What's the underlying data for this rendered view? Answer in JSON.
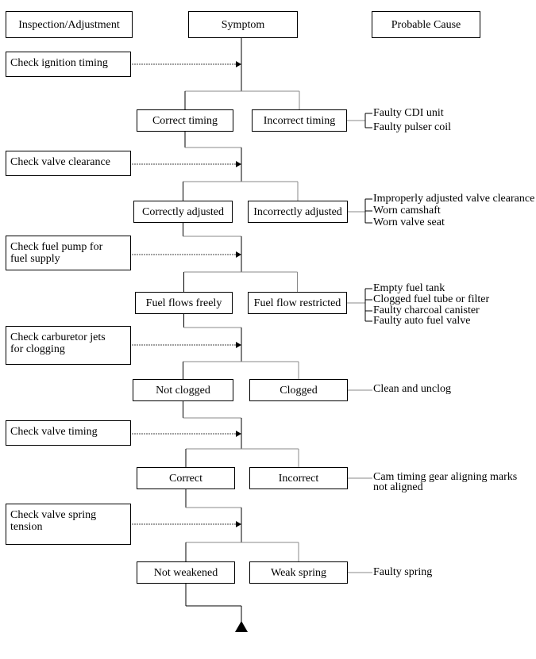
{
  "headers": {
    "inspection": "Inspection/Adjustment",
    "symptom": "Symptom",
    "cause": "Probable Cause"
  },
  "steps": [
    {
      "check": "Check ignition timing",
      "ok": "Correct timing",
      "ng": "Incorrect timing",
      "causes": [
        "Faulty CDI unit",
        "Faulty pulser coil"
      ]
    },
    {
      "check": "Check valve clearance",
      "ok": "Correctly adjusted",
      "ng": "Incorrectly adjusted",
      "causes": [
        "Improperly adjusted valve clearance",
        "Worn camshaft",
        "Worn valve seat"
      ]
    },
    {
      "check": "Check fuel pump for\nfuel supply",
      "ok": "Fuel flows freely",
      "ng": "Fuel flow restricted",
      "causes": [
        "Empty fuel tank",
        "Clogged fuel tube or filter",
        "Faulty charcoal canister",
        "Faulty auto fuel valve"
      ]
    },
    {
      "check": "Check carburetor jets\nfor clogging",
      "ok": "Not clogged",
      "ng": "Clogged",
      "causes": [
        "Clean and unclog"
      ]
    },
    {
      "check": "Check valve timing",
      "ok": "Correct",
      "ng": "Incorrect",
      "causes": [
        "Cam timing gear aligning marks\nnot aligned"
      ]
    },
    {
      "check": "Check valve spring\ntension",
      "ok": "Not weakened",
      "ng": "Weak spring",
      "causes": [
        "Faulty spring"
      ]
    }
  ],
  "colors": {
    "line": "#000000",
    "connector": "#888888"
  },
  "end_marker_icon": "triangle-up"
}
